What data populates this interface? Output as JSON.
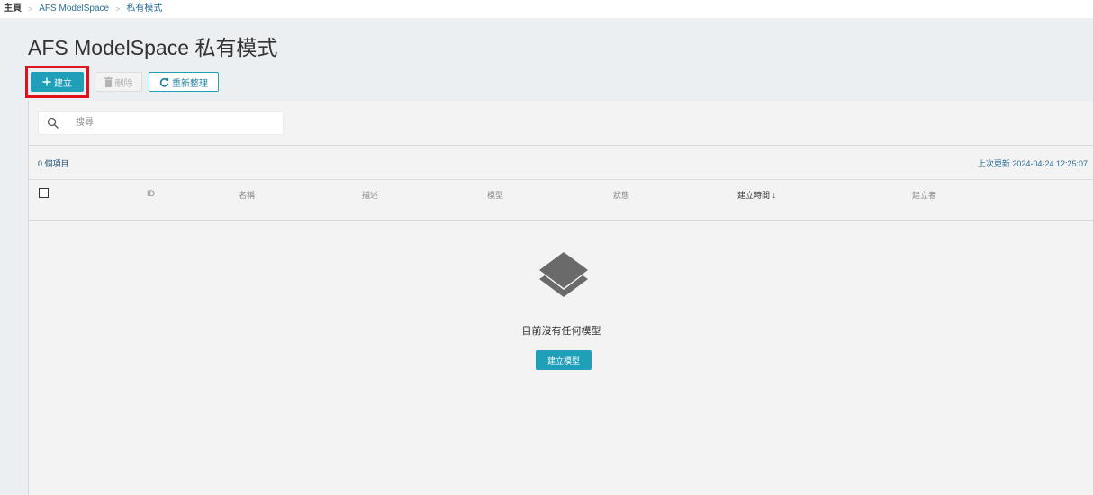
{
  "breadcrumb": {
    "home": "主頁",
    "separator": ">",
    "parent": "AFS ModelSpace",
    "current": "私有模式"
  },
  "page": {
    "title": "AFS ModelSpace 私有模式"
  },
  "toolbar": {
    "create_label": "建立",
    "delete_label": "刪除",
    "refresh_label": "重新整理"
  },
  "search": {
    "placeholder": "搜尋",
    "value": ""
  },
  "summary": {
    "count": "0 個項目",
    "last_updated": "上次更新 2024-04-24 12:25:07"
  },
  "table": {
    "columns": [
      "ID",
      "名稱",
      "描述",
      "模型",
      "狀態",
      "建立時間",
      "建立者"
    ],
    "sort_arrow": "↓",
    "rows": []
  },
  "empty": {
    "message": "目前沒有任何模型",
    "button_label": "建立模型",
    "icon": "layers-icon"
  },
  "colors": {
    "accent": "#1f9fb8",
    "highlight": "#e0101c",
    "background": "#eceff2",
    "panel": "#f3f3f3"
  }
}
